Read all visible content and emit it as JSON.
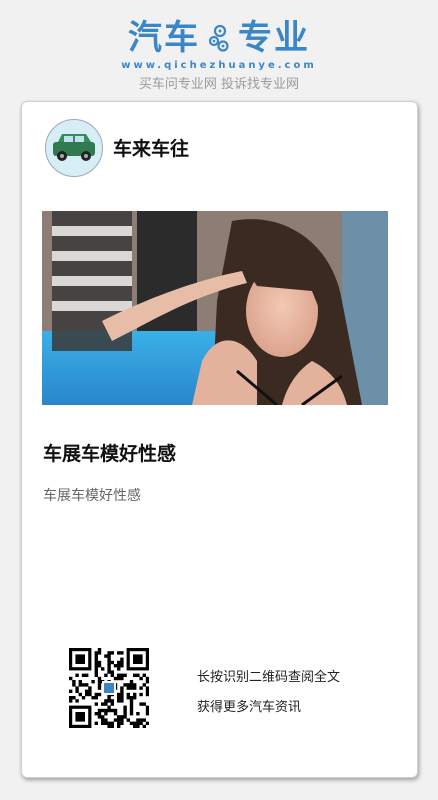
{
  "header": {
    "logo_left": "汽车",
    "logo_right": "专业",
    "logo_url": "www.qichezhuanye.com",
    "tagline": "买车问专业网 投诉找专业网",
    "icon": "gear-icon"
  },
  "card": {
    "author_name": "车来车往",
    "avatar_icon": "car-icon",
    "title": "车展车模好性感",
    "description": "车展车模好性感",
    "qr_line1": "长按识别二维码查阅全文",
    "qr_line2": "获得更多汽车资讯"
  },
  "colors": {
    "brand_blue": "#3b86c7",
    "avatar_bg": "#d8eef6",
    "car_green": "#2f7a4f"
  }
}
